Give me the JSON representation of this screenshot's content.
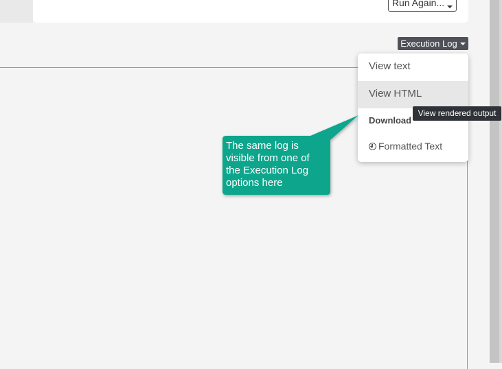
{
  "toolbar": {
    "run_again_label": "Run Again..."
  },
  "execution_log": {
    "button_label": "Execution Log",
    "menu": {
      "view_text": "View text",
      "view_html": "View HTML",
      "download_header": "Download",
      "formatted_text": "Formatted Text"
    }
  },
  "tooltip": {
    "text": "View rendered output"
  },
  "callout": {
    "lines": [
      "The same log is",
      "visible from one of",
      "the Execution Log",
      "options here"
    ],
    "color": "#0aa68c"
  },
  "colors": {
    "background": "#f4f4f4",
    "button_dark": "#4e5158",
    "tooltip_dark": "#2f3237",
    "menu_hover": "#e7e7e8"
  }
}
